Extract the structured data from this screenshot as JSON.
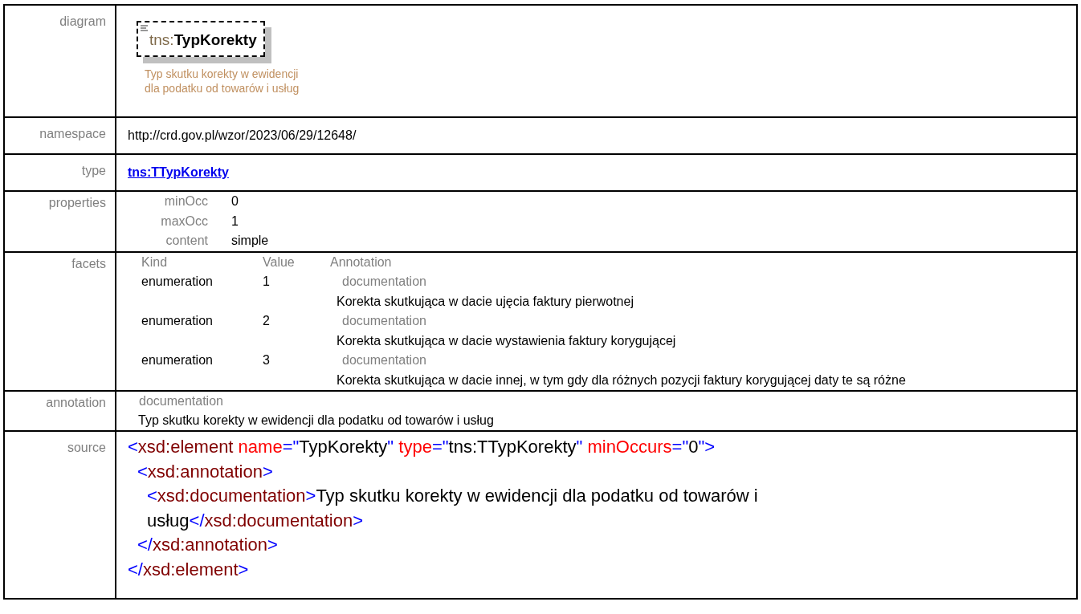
{
  "rows": [
    {
      "label": "diagram",
      "kind": "diagram",
      "prefix": "tns:",
      "name": "TypKorekty",
      "caption": [
        "Typ skutku korekty w ewidencji",
        "dla podatku od towarów i usług"
      ]
    },
    {
      "label": "namespace",
      "kind": "text",
      "value": "http://crd.gov.pl/wzor/2023/06/29/12648/"
    },
    {
      "label": "type",
      "kind": "link",
      "value": "tns:TTypKorekty"
    },
    {
      "label": "properties",
      "kind": "properties",
      "items": [
        {
          "name": "minOcc",
          "value": "0"
        },
        {
          "name": "maxOcc",
          "value": "1"
        },
        {
          "name": "content",
          "value": "simple"
        }
      ]
    },
    {
      "label": "facets",
      "kind": "facets",
      "columns": [
        "Kind",
        "Value",
        "Annotation"
      ],
      "items": [
        {
          "kind": "enumeration",
          "value": "1",
          "doc_label": "documentation",
          "doc": "Korekta skutkująca w dacie ujęcia faktury pierwotnej"
        },
        {
          "kind": "enumeration",
          "value": "2",
          "doc_label": "documentation",
          "doc": "Korekta skutkująca w dacie wystawienia faktury korygującej"
        },
        {
          "kind": "enumeration",
          "value": "3",
          "doc_label": "documentation",
          "doc": "Korekta skutkująca w dacie innej, w tym gdy dla różnych pozycji faktury korygującej daty te są różne"
        }
      ]
    },
    {
      "label": "annotation",
      "kind": "annotation",
      "doc_label": "documentation",
      "doc": "Typ skutku korekty w ewidencji dla podatku od towarów i usług"
    },
    {
      "label": "source",
      "kind": "source",
      "lines": [
        {
          "kind": "outer",
          "tokens": [
            {
              "kind": "bracket",
              "text": "<"
            },
            {
              "kind": "tag",
              "text": "xsd:element"
            },
            {
              "kind": "attr",
              "text": " name"
            },
            {
              "kind": "bracket",
              "text": "=\""
            },
            {
              "kind": "value",
              "text": "TypKorekty"
            },
            {
              "kind": "bracket",
              "text": "\""
            },
            {
              "kind": "attr",
              "text": " type"
            },
            {
              "kind": "bracket",
              "text": "=\""
            },
            {
              "kind": "value",
              "text": "tns:TTypKorekty"
            },
            {
              "kind": "bracket",
              "text": "\""
            },
            {
              "kind": "attr",
              "text": " minOccurs"
            },
            {
              "kind": "bracket",
              "text": "=\""
            },
            {
              "kind": "value",
              "text": "0"
            },
            {
              "kind": "bracket",
              "text": "\">"
            }
          ]
        },
        {
          "kind": "inner",
          "tokens": [
            {
              "kind": "bracket",
              "text": "<"
            },
            {
              "kind": "tag",
              "text": "xsd:annotation"
            },
            {
              "kind": "bracket",
              "text": ">"
            }
          ]
        },
        {
          "kind": "innermost",
          "tokens": [
            {
              "kind": "bracket",
              "text": "<"
            },
            {
              "kind": "tag",
              "text": "xsd:documentation"
            },
            {
              "kind": "bracket",
              "text": ">"
            },
            {
              "kind": "value",
              "text": "Typ skutku korekty w ewidencji dla podatku od towarów i usług"
            },
            {
              "kind": "bracket",
              "text": "</"
            },
            {
              "kind": "tag",
              "text": "xsd:documentation"
            },
            {
              "kind": "bracket",
              "text": ">"
            }
          ]
        },
        {
          "kind": "inner",
          "tokens": [
            {
              "kind": "bracket",
              "text": "</"
            },
            {
              "kind": "tag",
              "text": "xsd:annotation"
            },
            {
              "kind": "bracket",
              "text": ">"
            }
          ]
        },
        {
          "kind": "outer",
          "tokens": [
            {
              "kind": "bracket",
              "text": "</"
            },
            {
              "kind": "tag",
              "text": "xsd:element"
            },
            {
              "kind": "bracket",
              "text": ">"
            }
          ]
        }
      ]
    }
  ]
}
